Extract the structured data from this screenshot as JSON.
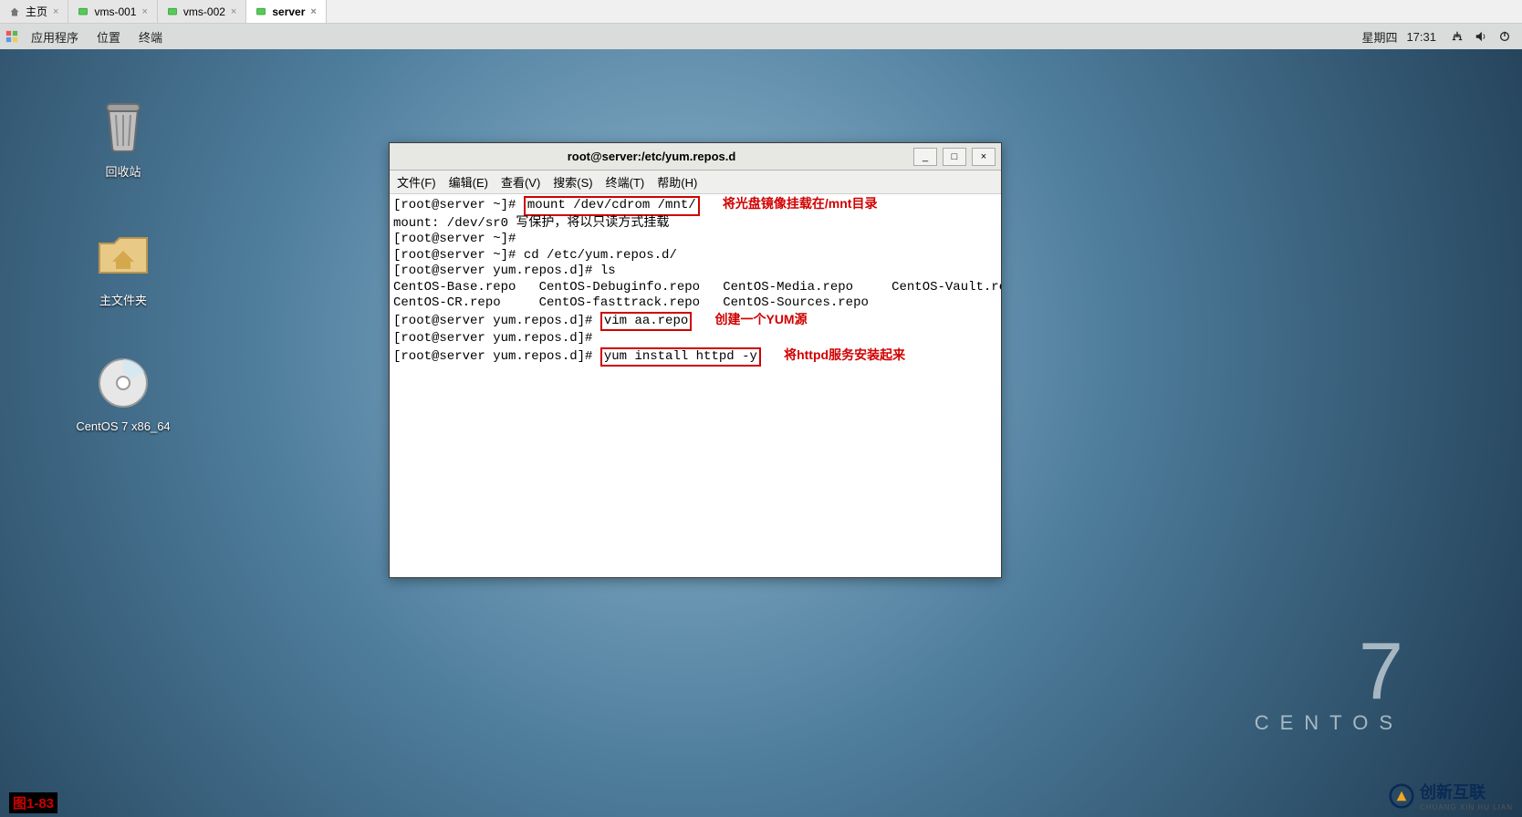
{
  "browser_tabs": [
    {
      "label": "主页",
      "icon": "home",
      "active": false
    },
    {
      "label": "vms-001",
      "icon": "vm",
      "active": false
    },
    {
      "label": "vms-002",
      "icon": "vm",
      "active": false
    },
    {
      "label": "server",
      "icon": "vm",
      "active": true
    }
  ],
  "panel": {
    "apps": "应用程序",
    "places": "位置",
    "terminal": "终端",
    "day": "星期四",
    "time": "17:31"
  },
  "desktop_icons": {
    "trash": "回收站",
    "home": "主文件夹",
    "disc": "CentOS 7 x86_64"
  },
  "terminal_window": {
    "title": "root@server:/etc/yum.repos.d",
    "menus": [
      "文件(F)",
      "编辑(E)",
      "查看(V)",
      "搜索(S)",
      "终端(T)",
      "帮助(H)"
    ],
    "btns": {
      "min": "_",
      "max": "□",
      "close": "×"
    }
  },
  "annotations": {
    "mount": "将光盘镜像挂载在/mnt目录",
    "vim": "创建一个YUM源",
    "yum": "将httpd服务安装起来"
  },
  "term_lines": {
    "l1_pre": "[root@server ~]# ",
    "l1_cmd": "mount /dev/cdrom /mnt/",
    "l2": "mount: /dev/sr0 写保护，将以只读方式挂载",
    "l3": "[root@server ~]# ",
    "l4": "[root@server ~]# cd /etc/yum.repos.d/",
    "l5": "[root@server yum.repos.d]# ls",
    "l6": "CentOS-Base.repo   CentOS-Debuginfo.repo   CentOS-Media.repo     CentOS-Vault.repo",
    "l7": "CentOS-CR.repo     CentOS-fasttrack.repo   CentOS-Sources.repo",
    "l8_pre": "[root@server yum.repos.d]# ",
    "l8_cmd": "vim aa.repo",
    "l9": "[root@server yum.repos.d]# ",
    "l10_pre": "[root@server yum.repos.d]# ",
    "l10_cmd": "yum install httpd -y"
  },
  "brand": {
    "seven": "7",
    "centos": "CENTOS"
  },
  "watermark": {
    "text": "创新互联",
    "sub": "CHUANG XIN HU LIAN"
  },
  "figure_label": "图1-83"
}
